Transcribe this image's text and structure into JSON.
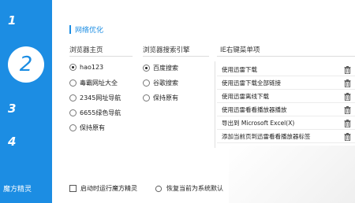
{
  "sidebar": {
    "steps": [
      {
        "num": "1"
      },
      {
        "num": "2"
      },
      {
        "num": "3"
      },
      {
        "num": "4"
      }
    ],
    "brand": "魔方精灵"
  },
  "section": {
    "title": "网络优化"
  },
  "browser_home": {
    "title": "浏览器主页",
    "options": [
      {
        "label": "hao123",
        "checked": true
      },
      {
        "label": "毒霸网址大全",
        "checked": false
      },
      {
        "label": "2345网址导航",
        "checked": false
      },
      {
        "label": "6655绿色导航",
        "checked": false
      },
      {
        "label": "保持原有",
        "checked": false
      }
    ]
  },
  "search_engine": {
    "title": "浏览器搜索引擎",
    "options": [
      {
        "label": "百度搜索",
        "checked": true
      },
      {
        "label": "谷歌搜索",
        "checked": false
      },
      {
        "label": "保持原有",
        "checked": false
      }
    ]
  },
  "context_menu": {
    "title": "IE右键菜单项",
    "items": [
      {
        "label": "使用迅雷下载"
      },
      {
        "label": "使用迅雷下载全部链接"
      },
      {
        "label": "使用迅雷离线下载"
      },
      {
        "label": "使用迅雷看看播放器播放"
      },
      {
        "label": "导出到 Microsoft Excel(X)"
      },
      {
        "label": "添加当前页到迅雷看看播放器标签"
      }
    ]
  },
  "bottom": {
    "autorun_label": "启动时运行魔方精灵",
    "restore_label": "恢复当前为系统默认"
  }
}
